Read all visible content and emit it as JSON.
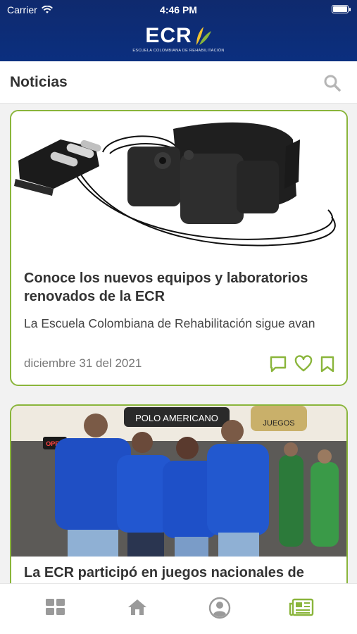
{
  "status_bar": {
    "carrier": "Carrier",
    "time": "4:46 PM"
  },
  "header": {
    "logo_text": "ECR",
    "logo_tagline": "ESCUELA COLOMBIANA DE REHABILITACIÓN"
  },
  "page": {
    "title": "Noticias"
  },
  "news": [
    {
      "title": "Conoce los nuevos equipos y laboratorios renovados de la ECR",
      "excerpt": "La Escuela Colombiana de Rehabilitación sigue avan",
      "date": "diciembre 31 del 2021"
    },
    {
      "title": "La ECR participó en juegos nacionales de",
      "sign_open": "OPEN",
      "sign_shop": "POLO AMERICANO",
      "sign_games": "JUEGOS"
    }
  ],
  "colors": {
    "header_blue": "#0b2f7f",
    "accent_green": "#8ab53b",
    "leaf_yellow": "#f2c230"
  }
}
